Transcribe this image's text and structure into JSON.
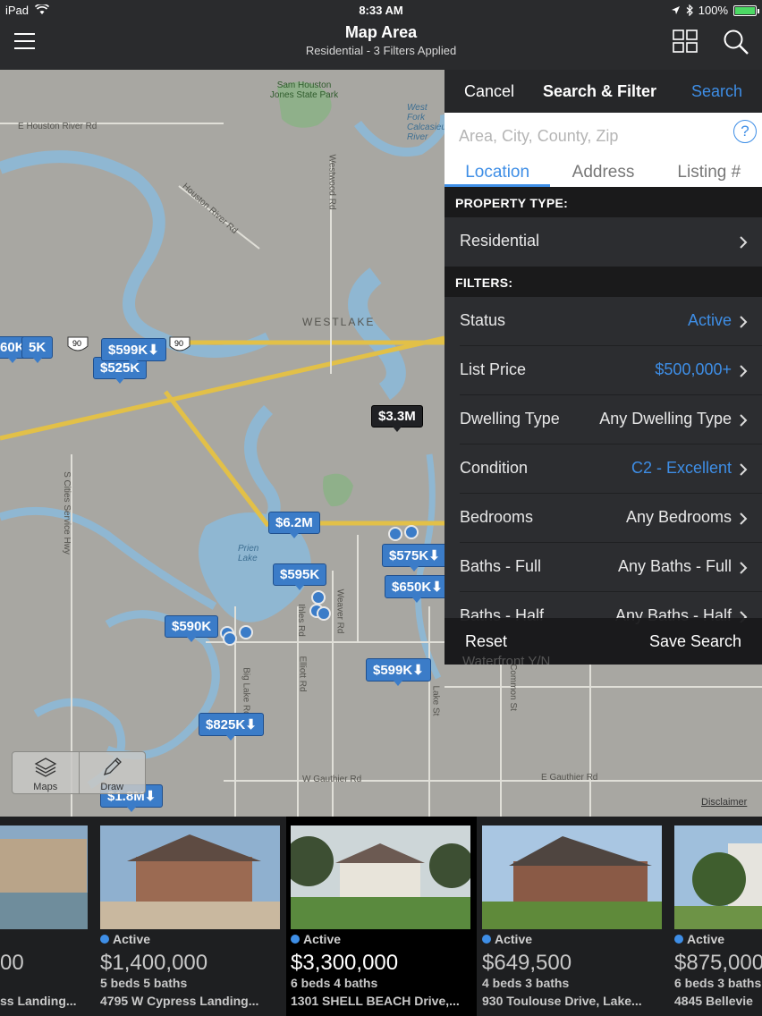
{
  "status_bar": {
    "device": "iPad",
    "time": "8:33 AM",
    "battery": "100%"
  },
  "header": {
    "title": "Map Area",
    "subtitle": "Residential - 3 Filters Applied"
  },
  "map": {
    "pins": [
      {
        "label": "60K"
      },
      {
        "label": "5K"
      },
      {
        "label": "$599K⬇"
      },
      {
        "label": "$525K"
      },
      {
        "label": "$3.3M"
      },
      {
        "label": "$6.2M"
      },
      {
        "label": "$575K⬇"
      },
      {
        "label": "$650K⬇"
      },
      {
        "label": "$595K"
      },
      {
        "label": "$590K"
      },
      {
        "label": "$599K⬇"
      },
      {
        "label": "$825K⬇"
      },
      {
        "label": "$1.8M⬇"
      }
    ],
    "labels": {
      "park": "Sam Houston Jones State Park",
      "e_houston_river": "E Houston River Rd",
      "houston_river": "Houston River Rd",
      "westwood": "Westwood Rd",
      "westlake": "WESTLAKE",
      "west_fork": "West Fork Calcasieu River",
      "cities_service": "S Cities Service Hwy",
      "prien_lake": "Prien Lake",
      "ihles": "Ihles Rd",
      "weaver": "Weaver Rd",
      "elliott": "Elliott Rd",
      "big_lake": "Big Lake Rd",
      "lake_st": "Lake St",
      "common_st": "Common St",
      "w_gauthier": "W Gauthier Rd",
      "e_gauthier": "E Gauthier Rd",
      "route_90": "90"
    },
    "buttons": {
      "maps": "Maps",
      "draw": "Draw"
    },
    "disclaimer": "Disclaimer"
  },
  "panel": {
    "cancel": "Cancel",
    "title": "Search & Filter",
    "search": "Search",
    "search_placeholder": "Area, City, County, Zip",
    "help": "?",
    "tabs": [
      "Location",
      "Address",
      "Listing #"
    ],
    "property_type_header": "PROPERTY TYPE:",
    "property_type": "Residential",
    "filters_header": "FILTERS:",
    "filters": [
      {
        "label": "Status",
        "value": "Active",
        "highlight": true
      },
      {
        "label": "List Price",
        "value": "$500,000+",
        "highlight": true
      },
      {
        "label": "Dwelling Type",
        "value": "Any Dwelling Type",
        "highlight": false
      },
      {
        "label": "Condition",
        "value": "C2 - Excellent",
        "highlight": true
      },
      {
        "label": "Bedrooms",
        "value": "Any Bedrooms",
        "highlight": false
      },
      {
        "label": "Baths - Full",
        "value": "Any Baths - Full",
        "highlight": false
      },
      {
        "label": "Baths - Half",
        "value": "Any Baths - Half",
        "highlight": false
      }
    ],
    "reset": "Reset",
    "save_search": "Save Search",
    "hidden_row": "Waterfront Y/N"
  },
  "listings": [
    {
      "status": "",
      "price": "00",
      "beds": "",
      "address": "ss Landing..."
    },
    {
      "status": "Active",
      "price": "$1,400,000",
      "beds": "5 beds 5 baths",
      "address": "4795 W Cypress Landing..."
    },
    {
      "status": "Active",
      "price": "$3,300,000",
      "beds": "6 beds 4 baths",
      "address": "1301 SHELL BEACH Drive,..."
    },
    {
      "status": "Active",
      "price": "$649,500",
      "beds": "4 beds 3 baths",
      "address": "930 Toulouse Drive, Lake..."
    },
    {
      "status": "Active",
      "price": "$875,000",
      "beds": "6 beds 3 baths",
      "address": "4845 Bellevie"
    }
  ],
  "colors": {
    "accent": "#3e8ee6",
    "pin": "#3b7cc8",
    "water": "#8fb7d2",
    "road": "#e2c048"
  }
}
